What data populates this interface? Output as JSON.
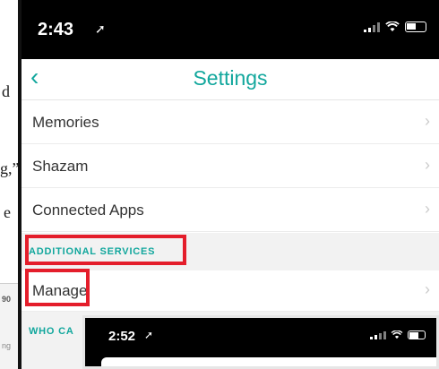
{
  "background": {
    "fragments": [
      "d",
      "g,”",
      "e"
    ],
    "card_number": "90",
    "card_text": "ng"
  },
  "phone": {
    "status": {
      "time": "2:43",
      "location_icon": "location-arrow-icon"
    },
    "nav": {
      "back_icon": "chevron-left-icon",
      "title": "Settings"
    },
    "rows_top": [
      {
        "label": "Memories"
      },
      {
        "label": "Shazam"
      },
      {
        "label": "Connected Apps"
      }
    ],
    "section_additional": "ADDITIONAL SERVICES",
    "row_manage": "Manage",
    "section_who": "WHO CA",
    "chevron_icon": "chevron-right-icon",
    "colors": {
      "accent": "#12a79d",
      "highlight": "#e41e2b"
    }
  },
  "phone2": {
    "status": {
      "time": "2:52"
    }
  }
}
